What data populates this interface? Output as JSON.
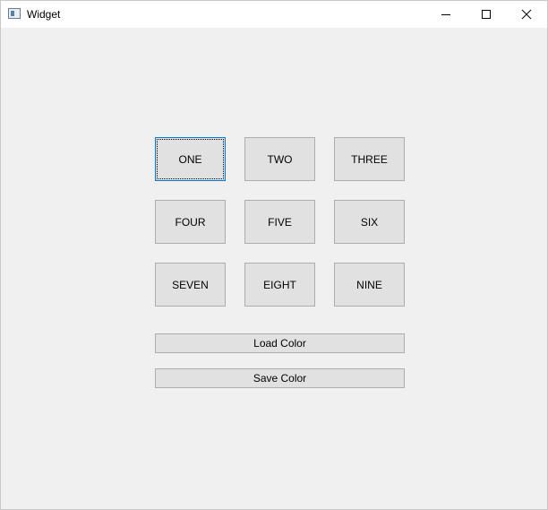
{
  "window": {
    "title": "Widget",
    "icon": "window-app-icon"
  },
  "titlebar_controls": {
    "minimize_icon": "minimize-icon",
    "maximize_icon": "maximize-icon",
    "close_icon": "close-icon"
  },
  "grid_buttons": [
    "ONE",
    "TWO",
    "THREE",
    "FOUR",
    "FIVE",
    "SIX",
    "SEVEN",
    "EIGHT",
    "NINE"
  ],
  "actions": {
    "load_color": "Load Color",
    "save_color": "Save Color"
  },
  "colors": {
    "window_bg": "#f0f0f0",
    "button_bg": "#e1e1e1",
    "button_border": "#adadad",
    "focus_border": "#0078d7"
  }
}
